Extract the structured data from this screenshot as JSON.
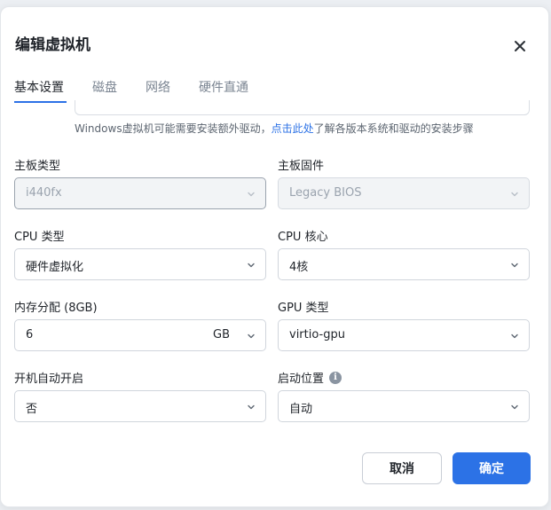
{
  "dialog": {
    "title": "编辑虚拟机",
    "close_icon": "close-icon"
  },
  "tabs": [
    {
      "label": "基本设置",
      "active": true
    },
    {
      "label": "磁盘",
      "active": false
    },
    {
      "label": "网络",
      "active": false
    },
    {
      "label": "硬件直通",
      "active": false
    }
  ],
  "hint": {
    "prefix": "Windows虚拟机可能需要安装额外驱动，",
    "link": "点击此处",
    "suffix": "了解各版本系统和驱动的安装步骤"
  },
  "fields": {
    "motherboard_type": {
      "label": "主板类型",
      "value": "i440fx",
      "disabled": true
    },
    "motherboard_firmware": {
      "label": "主板固件",
      "value": "Legacy BIOS",
      "disabled": true
    },
    "cpu_type": {
      "label": "CPU 类型",
      "value": "硬件虚拟化"
    },
    "cpu_cores": {
      "label": "CPU 核心",
      "value": "4核"
    },
    "memory": {
      "label": "内存分配 (8GB)",
      "value": "6",
      "unit": "GB"
    },
    "gpu_type": {
      "label": "GPU 类型",
      "value": "virtio-gpu"
    },
    "autostart": {
      "label": "开机自动开启",
      "value": "否"
    },
    "boot_position": {
      "label": "启动位置",
      "value": "自动",
      "info_icon": "info-icon"
    }
  },
  "buttons": {
    "cancel": "取消",
    "ok": "确定"
  },
  "colors": {
    "accent": "#2c72e6",
    "text": "#1f2329",
    "muted": "#7b8592"
  }
}
